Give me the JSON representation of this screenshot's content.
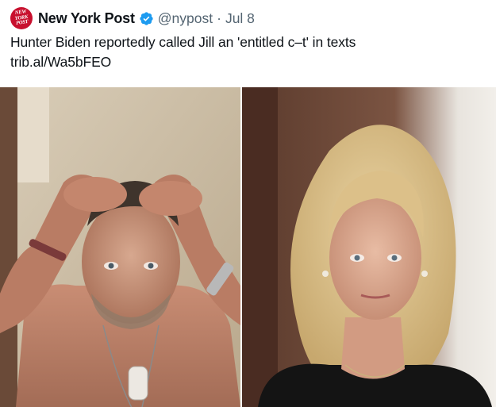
{
  "tweet": {
    "author": {
      "name": "New York Post",
      "handle": "@nypost",
      "avatar_text": "NEW YORK POST",
      "avatar_color": "#c8102e",
      "verified": true,
      "verified_color": "#1d9bf0"
    },
    "separator": "·",
    "date": "Jul 8",
    "text": "Hunter Biden reportedly called Jill an 'entitled c–t' in texts",
    "link": "trib.al/Wa5bFEO",
    "media": [
      {
        "icon": "photo-shirtless-man"
      },
      {
        "icon": "photo-blonde-woman"
      }
    ]
  }
}
